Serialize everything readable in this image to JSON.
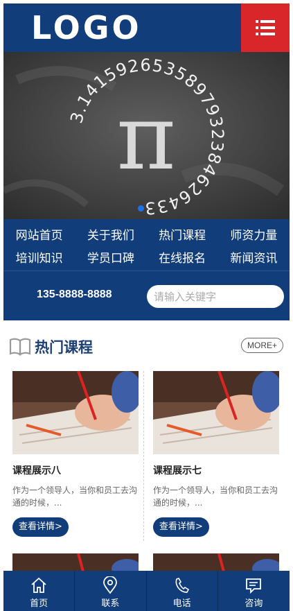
{
  "header": {
    "logo_text": "LOGO",
    "menu_icon": "menu-icon"
  },
  "banner": {
    "pi_symbol": "π",
    "digits": "3.1415926535897932384626433"
  },
  "nav": {
    "items": [
      {
        "label": "网站首页"
      },
      {
        "label": "关于我们"
      },
      {
        "label": "热门课程"
      },
      {
        "label": "师资力量"
      },
      {
        "label": "培训知识"
      },
      {
        "label": "学员口碑"
      },
      {
        "label": "在线报名"
      },
      {
        "label": "新闻资讯"
      }
    ]
  },
  "contact": {
    "phone": "135-8888-8888",
    "search_placeholder": "请输入关键字"
  },
  "section": {
    "title": "热门课程",
    "more_label": "MORE+",
    "icon": "book-icon"
  },
  "cards": [
    {
      "title": "课程展示八",
      "desc": "作为一个领导人，当你和员工去沟通的时候，...",
      "button": "查看详情>"
    },
    {
      "title": "课程展示七",
      "desc": "作为一个领导人，当你和员工去沟通的时候，...",
      "button": "查看详情>"
    }
  ],
  "tabbar": {
    "items": [
      {
        "label": "首页",
        "icon": "home-icon"
      },
      {
        "label": "联系",
        "icon": "location-icon"
      },
      {
        "label": "电话",
        "icon": "phone-icon"
      },
      {
        "label": "咨询",
        "icon": "chat-icon"
      }
    ]
  },
  "colors": {
    "primary": "#113d7a",
    "accent": "#d8262a",
    "dot": "#1a73e8"
  }
}
